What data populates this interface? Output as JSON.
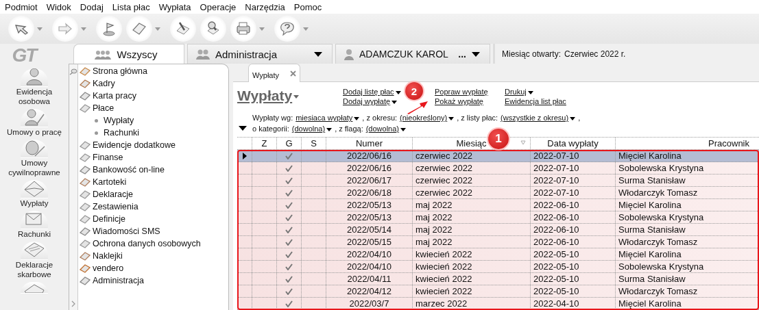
{
  "menu": [
    "Podmiot",
    "Widok",
    "Dodaj",
    "Lista płac",
    "Wypłata",
    "Operacje",
    "Narzędzia",
    "Pomoc"
  ],
  "toolbar": [
    {
      "dropdown": true
    },
    {
      "dropdown": true
    },
    {
      "dropdown": false
    },
    {
      "dropdown": true
    },
    {
      "dropdown": false
    },
    {
      "dropdown": false
    },
    {
      "dropdown": true
    },
    {
      "dropdown": true
    }
  ],
  "logo": "GT",
  "nav": [
    {
      "label": "Ewidencja osobowa"
    },
    {
      "label": "Umowy o pracę"
    },
    {
      "label": "Umowy cywilnoprawne"
    },
    {
      "label": "Wypłaty"
    },
    {
      "label": "Rachunki"
    },
    {
      "label": "Deklaracje skarbowe"
    }
  ],
  "tabs": [
    {
      "label": "Wszyscy",
      "selected": true,
      "dropdown": false
    },
    {
      "label": "Administracja",
      "selected": false,
      "dropdown": true
    },
    {
      "label": "ADAMCZUK KAROL",
      "extra": "...",
      "selected": false,
      "dropdown": true
    }
  ],
  "open_month": {
    "label": "Miesiąc otwarty:",
    "value": "Czerwiec 2022 r."
  },
  "tree": [
    {
      "label": "Strona główna"
    },
    {
      "label": "Kadry"
    },
    {
      "label": "Karta pracy"
    },
    {
      "label": "Płace",
      "children": [
        {
          "label": "Wypłaty"
        },
        {
          "label": "Rachunki"
        }
      ]
    },
    {
      "label": "Ewidencje dodatkowe"
    },
    {
      "label": "Finanse"
    },
    {
      "label": "Bankowość on-line"
    },
    {
      "label": "Kartoteki"
    },
    {
      "label": "Deklaracje"
    },
    {
      "label": "Zestawienia"
    },
    {
      "label": "Definicje"
    },
    {
      "label": "Wiadomości SMS"
    },
    {
      "label": "Ochrona danych osobowych"
    },
    {
      "label": "Naklejki"
    },
    {
      "label": "vendero"
    },
    {
      "label": "Administracja"
    }
  ],
  "doc_tab": {
    "label": "Wypłaty"
  },
  "page_title": "Wypłaty",
  "actions": [
    [
      {
        "label": "Dodaj listę płac",
        "dropdown": true
      },
      {
        "label": "Dodaj wypłatę",
        "dropdown": true
      }
    ],
    [
      {
        "label": "Popraw wypłatę",
        "dropdown": false
      },
      {
        "label": "Pokaż wypłatę",
        "dropdown": false
      }
    ],
    [
      {
        "label": "Drukuj",
        "dropdown": true
      },
      {
        "label": "Ewidencja list płac",
        "dropdown": false
      }
    ]
  ],
  "filters": [
    [
      {
        "kind": "text",
        "text": "Wypłaty wg:"
      },
      {
        "kind": "link",
        "text": "miesiaca wypłaty"
      },
      {
        "kind": "text",
        "text": ", z okresu:"
      },
      {
        "kind": "link",
        "text": "(nieokreślony)"
      },
      {
        "kind": "text",
        "text": ", z listy płac:"
      },
      {
        "kind": "link",
        "text": "(wszystkie z okresu)"
      },
      {
        "kind": "text",
        "text": ","
      }
    ],
    [
      {
        "kind": "text",
        "text": "o kategorii:"
      },
      {
        "kind": "link",
        "text": "(dowolna)"
      },
      {
        "kind": "text",
        "text": ", z flagą:"
      },
      {
        "kind": "link",
        "text": "(dowolna)"
      }
    ]
  ],
  "table": {
    "columns": [
      "Z",
      "G",
      "S",
      "Numer",
      "Miesiąc",
      "Data wypłaty",
      "Pracownik"
    ],
    "rows": [
      {
        "numer": "2022/06/16",
        "miesiac": "czerwiec 2022",
        "data": "2022-07-10",
        "pracownik": "Mięciel Karolina",
        "g": true,
        "selected": true
      },
      {
        "numer": "2022/06/16",
        "miesiac": "czerwiec 2022",
        "data": "2022-07-10",
        "pracownik": "Sobolewska Krystyna",
        "g": true,
        "selected": false
      },
      {
        "numer": "2022/06/17",
        "miesiac": "czerwiec 2022",
        "data": "2022-07-10",
        "pracownik": "Surma Stanisław",
        "g": true,
        "selected": false
      },
      {
        "numer": "2022/06/18",
        "miesiac": "czerwiec 2022",
        "data": "2022-07-10",
        "pracownik": "Włodarczyk Tomasz",
        "g": true,
        "selected": false
      },
      {
        "numer": "2022/05/13",
        "miesiac": "maj 2022",
        "data": "2022-06-10",
        "pracownik": "Mięciel Karolina",
        "g": true,
        "selected": false
      },
      {
        "numer": "2022/05/13",
        "miesiac": "maj 2022",
        "data": "2022-06-10",
        "pracownik": "Sobolewska Krystyna",
        "g": true,
        "selected": false
      },
      {
        "numer": "2022/05/14",
        "miesiac": "maj 2022",
        "data": "2022-06-10",
        "pracownik": "Surma Stanisław",
        "g": true,
        "selected": false
      },
      {
        "numer": "2022/05/15",
        "miesiac": "maj 2022",
        "data": "2022-06-10",
        "pracownik": "Włodarczyk Tomasz",
        "g": true,
        "selected": false
      },
      {
        "numer": "2022/04/10",
        "miesiac": "kwiecień 2022",
        "data": "2022-05-10",
        "pracownik": "Mięciel Karolina",
        "g": true,
        "selected": false
      },
      {
        "numer": "2022/04/10",
        "miesiac": "kwiecień 2022",
        "data": "2022-05-10",
        "pracownik": "Sobolewska Krystyna",
        "g": true,
        "selected": false
      },
      {
        "numer": "2022/04/11",
        "miesiac": "kwiecień 2022",
        "data": "2022-05-10",
        "pracownik": "Surma Stanisław",
        "g": true,
        "selected": false
      },
      {
        "numer": "2022/04/12",
        "miesiac": "kwiecień 2022",
        "data": "2022-05-10",
        "pracownik": "Włodarczyk Tomasz",
        "g": true,
        "selected": false
      },
      {
        "numer": "2022/03/7",
        "miesiac": "marzec 2022",
        "data": "2022-04-10",
        "pracownik": "Mięciel Karolina",
        "g": true,
        "selected": false
      }
    ]
  },
  "annotations": [
    {
      "label": "1"
    },
    {
      "label": "2"
    }
  ]
}
